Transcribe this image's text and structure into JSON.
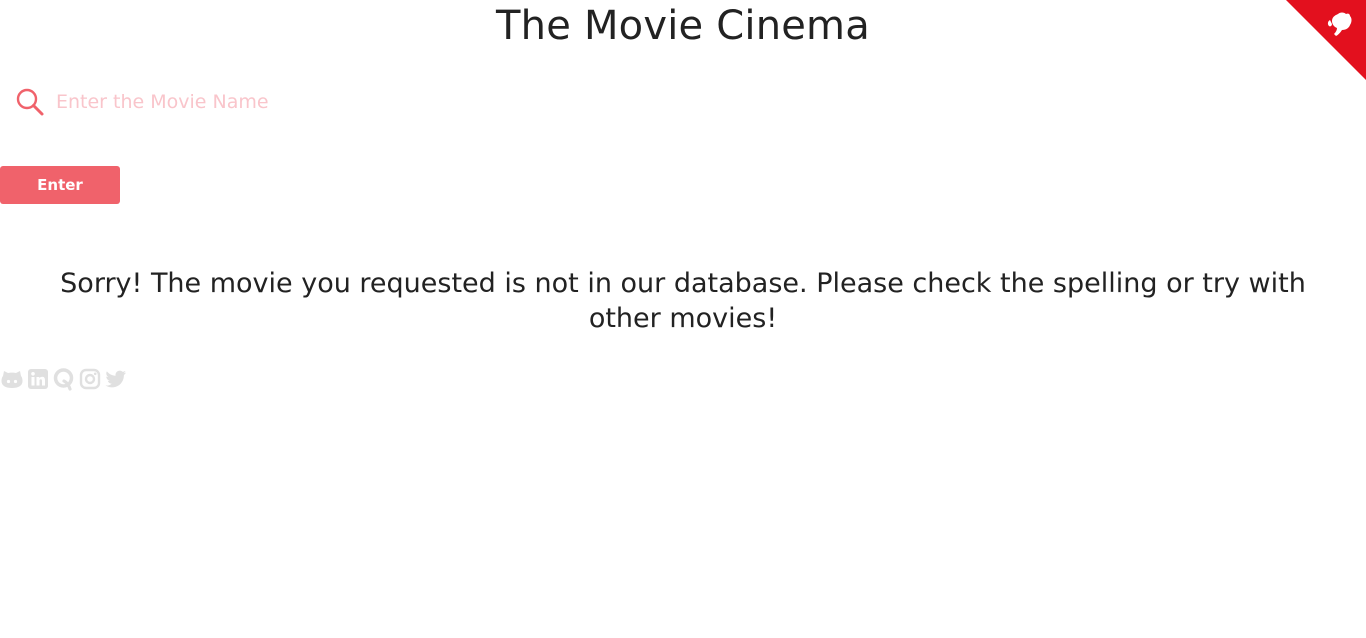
{
  "header": {
    "title": "The Movie Cinema"
  },
  "search": {
    "placeholder": "Enter the Movie Name",
    "value": "",
    "icon": "search-icon",
    "button_label": "Enter"
  },
  "main": {
    "message": "Sorry! The movie you requested is not in our database. Please check the spelling or try with other movies!"
  },
  "socials": [
    {
      "name": "github",
      "icon": "github-icon"
    },
    {
      "name": "linkedin",
      "icon": "linkedin-icon"
    },
    {
      "name": "quora",
      "icon": "quora-icon"
    },
    {
      "name": "instagram",
      "icon": "instagram-icon"
    },
    {
      "name": "twitter",
      "icon": "twitter-icon"
    }
  ],
  "corner": {
    "icon": "github-corner-icon"
  },
  "colors": {
    "accent": "#f0626b",
    "placeholder": "#f9c5cb",
    "corner": "#e3101e",
    "social_icons": "#e0e0e0",
    "text": "#222222"
  }
}
